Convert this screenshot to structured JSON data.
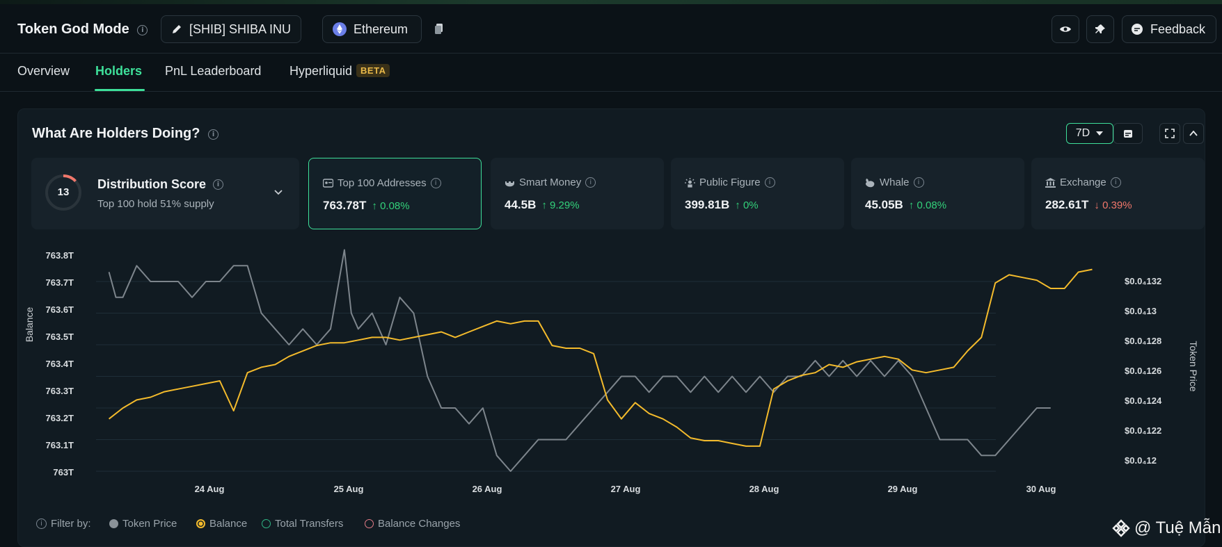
{
  "header": {
    "title": "Token God Mode",
    "token_label": "[SHIB] SHIBA INU",
    "chain_label": "Ethereum",
    "feedback_label": "Feedback"
  },
  "tabs": [
    {
      "label": "Overview"
    },
    {
      "label": "Holders",
      "active": true
    },
    {
      "label": "PnL Leaderboard"
    },
    {
      "label": "Hyperliquid",
      "badge": "BETA"
    }
  ],
  "card": {
    "title": "What Are Holders Doing?",
    "range_label": "7D"
  },
  "distribution": {
    "score": "13",
    "score_fraction": 0.13,
    "title": "Distribution Score",
    "subtitle": "Top 100 hold 51% supply"
  },
  "stats": [
    {
      "label": "Top 100 Addresses",
      "value": "763.78T",
      "change": "0.08%",
      "direction": "up",
      "icon": "address-book-icon",
      "selected": true
    },
    {
      "label": "Smart Money",
      "value": "44.5B",
      "change": "9.29%",
      "direction": "up",
      "icon": "smart-money-icon"
    },
    {
      "label": "Public Figure",
      "value": "399.81B",
      "change": "0%",
      "direction": "up",
      "icon": "public-figure-icon"
    },
    {
      "label": "Whale",
      "value": "45.05B",
      "change": "0.08%",
      "direction": "up",
      "icon": "whale-icon"
    },
    {
      "label": "Exchange",
      "value": "282.61T",
      "change": "0.39%",
      "direction": "down",
      "icon": "bank-icon"
    }
  ],
  "chart_data": {
    "type": "line",
    "ylabel": "Balance",
    "y2label": "Token Price",
    "ylim": [
      763.0,
      763.8
    ],
    "y2lim": [
      1.19e-05,
      1.34e-05
    ],
    "y_ticks": [
      "763.8T",
      "763.7T",
      "763.6T",
      "763.5T",
      "763.4T",
      "763.3T",
      "763.2T",
      "763.1T",
      "763T"
    ],
    "y2_ticks": [
      "$0.0₄132",
      "$0.0₄13",
      "$0.0₄128",
      "$0.0₄126",
      "$0.0₄124",
      "$0.0₄122",
      "$0.0₄12"
    ],
    "x_ticks": [
      "24 Aug",
      "25 Aug",
      "26 Aug",
      "27 Aug",
      "28 Aug",
      "29 Aug",
      "30 Aug"
    ],
    "x_start_day": 23.4,
    "x_end_day": 30.5,
    "grid": true,
    "colors": {
      "balance": "#f4bb2c",
      "price": "#7d858c"
    },
    "series": [
      {
        "name": "Balance",
        "points": [
          [
            23.4,
            763.2
          ],
          [
            23.5,
            763.24
          ],
          [
            23.6,
            763.27
          ],
          [
            23.7,
            763.28
          ],
          [
            23.8,
            763.3
          ],
          [
            23.9,
            763.31
          ],
          [
            24.0,
            763.32
          ],
          [
            24.1,
            763.33
          ],
          [
            24.2,
            763.34
          ],
          [
            24.3,
            763.23
          ],
          [
            24.4,
            763.37
          ],
          [
            24.5,
            763.39
          ],
          [
            24.6,
            763.4
          ],
          [
            24.7,
            763.43
          ],
          [
            24.8,
            763.45
          ],
          [
            24.9,
            763.47
          ],
          [
            25.0,
            763.48
          ],
          [
            25.1,
            763.48
          ],
          [
            25.2,
            763.49
          ],
          [
            25.3,
            763.5
          ],
          [
            25.4,
            763.5
          ],
          [
            25.5,
            763.49
          ],
          [
            25.6,
            763.5
          ],
          [
            25.7,
            763.51
          ],
          [
            25.8,
            763.52
          ],
          [
            25.9,
            763.5
          ],
          [
            26.0,
            763.52
          ],
          [
            26.1,
            763.54
          ],
          [
            26.2,
            763.56
          ],
          [
            26.3,
            763.55
          ],
          [
            26.4,
            763.56
          ],
          [
            26.5,
            763.56
          ],
          [
            26.6,
            763.47
          ],
          [
            26.7,
            763.46
          ],
          [
            26.8,
            763.46
          ],
          [
            26.9,
            763.44
          ],
          [
            27.0,
            763.27
          ],
          [
            27.1,
            763.2
          ],
          [
            27.2,
            763.26
          ],
          [
            27.3,
            763.22
          ],
          [
            27.4,
            763.2
          ],
          [
            27.5,
            763.17
          ],
          [
            27.6,
            763.13
          ],
          [
            27.7,
            763.12
          ],
          [
            27.8,
            763.12
          ],
          [
            27.9,
            763.11
          ],
          [
            28.0,
            763.1
          ],
          [
            28.1,
            763.1
          ],
          [
            28.2,
            763.31
          ],
          [
            28.3,
            763.34
          ],
          [
            28.4,
            763.36
          ],
          [
            28.5,
            763.37
          ],
          [
            28.6,
            763.4
          ],
          [
            28.7,
            763.39
          ],
          [
            28.8,
            763.41
          ],
          [
            28.9,
            763.42
          ],
          [
            29.0,
            763.43
          ],
          [
            29.1,
            763.42
          ],
          [
            29.2,
            763.38
          ],
          [
            29.3,
            763.37
          ],
          [
            29.4,
            763.38
          ],
          [
            29.5,
            763.39
          ],
          [
            29.6,
            763.45
          ],
          [
            29.7,
            763.5
          ],
          [
            29.8,
            763.7
          ],
          [
            29.9,
            763.73
          ],
          [
            30.0,
            763.72
          ],
          [
            30.1,
            763.71
          ],
          [
            30.2,
            763.68
          ],
          [
            30.3,
            763.68
          ],
          [
            30.4,
            763.74
          ],
          [
            30.5,
            763.75
          ]
        ]
      },
      {
        "name": "Token Price",
        "points": [
          [
            23.4,
            1.326e-05
          ],
          [
            23.45,
            1.31e-05
          ],
          [
            23.5,
            1.31e-05
          ],
          [
            23.6,
            1.33e-05
          ],
          [
            23.7,
            1.32e-05
          ],
          [
            23.8,
            1.32e-05
          ],
          [
            23.9,
            1.32e-05
          ],
          [
            24.0,
            1.31e-05
          ],
          [
            24.1,
            1.32e-05
          ],
          [
            24.2,
            1.32e-05
          ],
          [
            24.3,
            1.33e-05
          ],
          [
            24.4,
            1.33e-05
          ],
          [
            24.5,
            1.3e-05
          ],
          [
            24.6,
            1.29e-05
          ],
          [
            24.7,
            1.28e-05
          ],
          [
            24.8,
            1.29e-05
          ],
          [
            24.9,
            1.28e-05
          ],
          [
            25.0,
            1.29e-05
          ],
          [
            25.1,
            1.34e-05
          ],
          [
            25.15,
            1.3e-05
          ],
          [
            25.2,
            1.29e-05
          ],
          [
            25.3,
            1.3e-05
          ],
          [
            25.4,
            1.28e-05
          ],
          [
            25.5,
            1.31e-05
          ],
          [
            25.6,
            1.3e-05
          ],
          [
            25.7,
            1.26e-05
          ],
          [
            25.8,
            1.24e-05
          ],
          [
            25.9,
            1.24e-05
          ],
          [
            26.0,
            1.23e-05
          ],
          [
            26.1,
            1.24e-05
          ],
          [
            26.2,
            1.21e-05
          ],
          [
            26.3,
            1.2e-05
          ],
          [
            26.4,
            1.21e-05
          ],
          [
            26.5,
            1.22e-05
          ],
          [
            26.6,
            1.22e-05
          ],
          [
            26.7,
            1.22e-05
          ],
          [
            26.8,
            1.23e-05
          ],
          [
            26.9,
            1.24e-05
          ],
          [
            27.0,
            1.25e-05
          ],
          [
            27.1,
            1.26e-05
          ],
          [
            27.2,
            1.26e-05
          ],
          [
            27.3,
            1.25e-05
          ],
          [
            27.4,
            1.26e-05
          ],
          [
            27.5,
            1.26e-05
          ],
          [
            27.6,
            1.25e-05
          ],
          [
            27.7,
            1.26e-05
          ],
          [
            27.8,
            1.25e-05
          ],
          [
            27.9,
            1.26e-05
          ],
          [
            28.0,
            1.25e-05
          ],
          [
            28.1,
            1.26e-05
          ],
          [
            28.2,
            1.25e-05
          ],
          [
            28.3,
            1.26e-05
          ],
          [
            28.4,
            1.26e-05
          ],
          [
            28.5,
            1.27e-05
          ],
          [
            28.6,
            1.26e-05
          ],
          [
            28.7,
            1.27e-05
          ],
          [
            28.8,
            1.26e-05
          ],
          [
            28.9,
            1.27e-05
          ],
          [
            29.0,
            1.26e-05
          ],
          [
            29.1,
            1.27e-05
          ],
          [
            29.2,
            1.26e-05
          ],
          [
            29.3,
            1.24e-05
          ],
          [
            29.4,
            1.22e-05
          ],
          [
            29.5,
            1.22e-05
          ],
          [
            29.6,
            1.22e-05
          ],
          [
            29.7,
            1.21e-05
          ],
          [
            29.8,
            1.21e-05
          ],
          [
            29.9,
            1.22e-05
          ],
          [
            30.0,
            1.23e-05
          ],
          [
            30.1,
            1.24e-05
          ],
          [
            30.2,
            1.24e-05
          ]
        ]
      }
    ]
  },
  "filters": {
    "label": "Filter by:",
    "items": [
      {
        "label": "Token Price",
        "color": "#8a9298",
        "style": "filled"
      },
      {
        "label": "Balance",
        "color": "#f4bb2c",
        "style": "ring-filled"
      },
      {
        "label": "Total Transfers",
        "color": "#2fb383",
        "style": "ring"
      },
      {
        "label": "Balance Changes",
        "color": "#e27b86",
        "style": "ring"
      }
    ]
  },
  "watermark": "@ Tuệ Mẫn"
}
